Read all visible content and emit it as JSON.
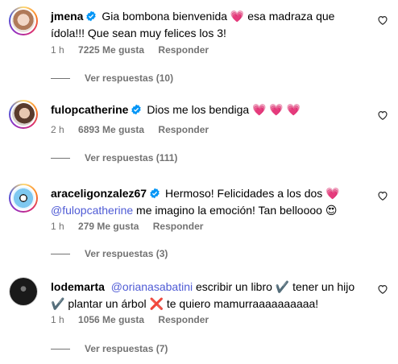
{
  "comments": [
    {
      "username": "jmena",
      "verified": true,
      "segments": [
        {
          "type": "text",
          "value": "Gia bombona bienvenida "
        },
        {
          "type": "emoji",
          "value": "💗"
        },
        {
          "type": "text",
          "value": " esa madraza que ídola!!! Que sean muy felices los 3!"
        }
      ],
      "time": "1 h",
      "likes": "7225 Me gusta",
      "reply_label": "Responder",
      "view_replies": "Ver respuestas (10)"
    },
    {
      "username": "fulopcatherine",
      "verified": true,
      "segments": [
        {
          "type": "text",
          "value": "Dios me los bendiga "
        },
        {
          "type": "emoji",
          "value": "💗 💗 💗"
        }
      ],
      "time": "2 h",
      "likes": "6893 Me gusta",
      "reply_label": "Responder",
      "view_replies": "Ver respuestas (111)"
    },
    {
      "username": "araceligonzalez67",
      "verified": true,
      "segments": [
        {
          "type": "text",
          "value": "Hermoso! Felicidades a los dos "
        },
        {
          "type": "emoji",
          "value": "💗"
        },
        {
          "type": "mention",
          "value": "@fulopcatherine"
        },
        {
          "type": "text",
          "value": " me imagino la emoción! Tan belloooo "
        },
        {
          "type": "emoji",
          "value": "😍"
        }
      ],
      "time": "1 h",
      "likes": "279 Me gusta",
      "reply_label": "Responder",
      "view_replies": "Ver respuestas (3)"
    },
    {
      "username": "lodemarta",
      "verified": false,
      "segments": [
        {
          "type": "mention",
          "value": "@orianasabatini"
        },
        {
          "type": "text",
          "value": " escribir un libro "
        },
        {
          "type": "emoji",
          "value": "✔️"
        },
        {
          "type": "text",
          "value": " tener un hijo "
        },
        {
          "type": "emoji",
          "value": "✔️"
        },
        {
          "type": "text",
          "value": " plantar un árbol "
        },
        {
          "type": "emoji",
          "value": "❌"
        },
        {
          "type": "text",
          "value": " te quiero mamurraaaaaaaaaa!"
        }
      ],
      "time": "1 h",
      "likes": "1056 Me gusta",
      "reply_label": "Responder",
      "view_replies": "Ver respuestas (7)"
    }
  ],
  "colors": {
    "secondary_text": "#737373",
    "mention": "#4f5bd5",
    "verified": "#0095f6"
  },
  "icons": {
    "verified": "verified-badge-icon",
    "like": "heart-outline-icon"
  }
}
